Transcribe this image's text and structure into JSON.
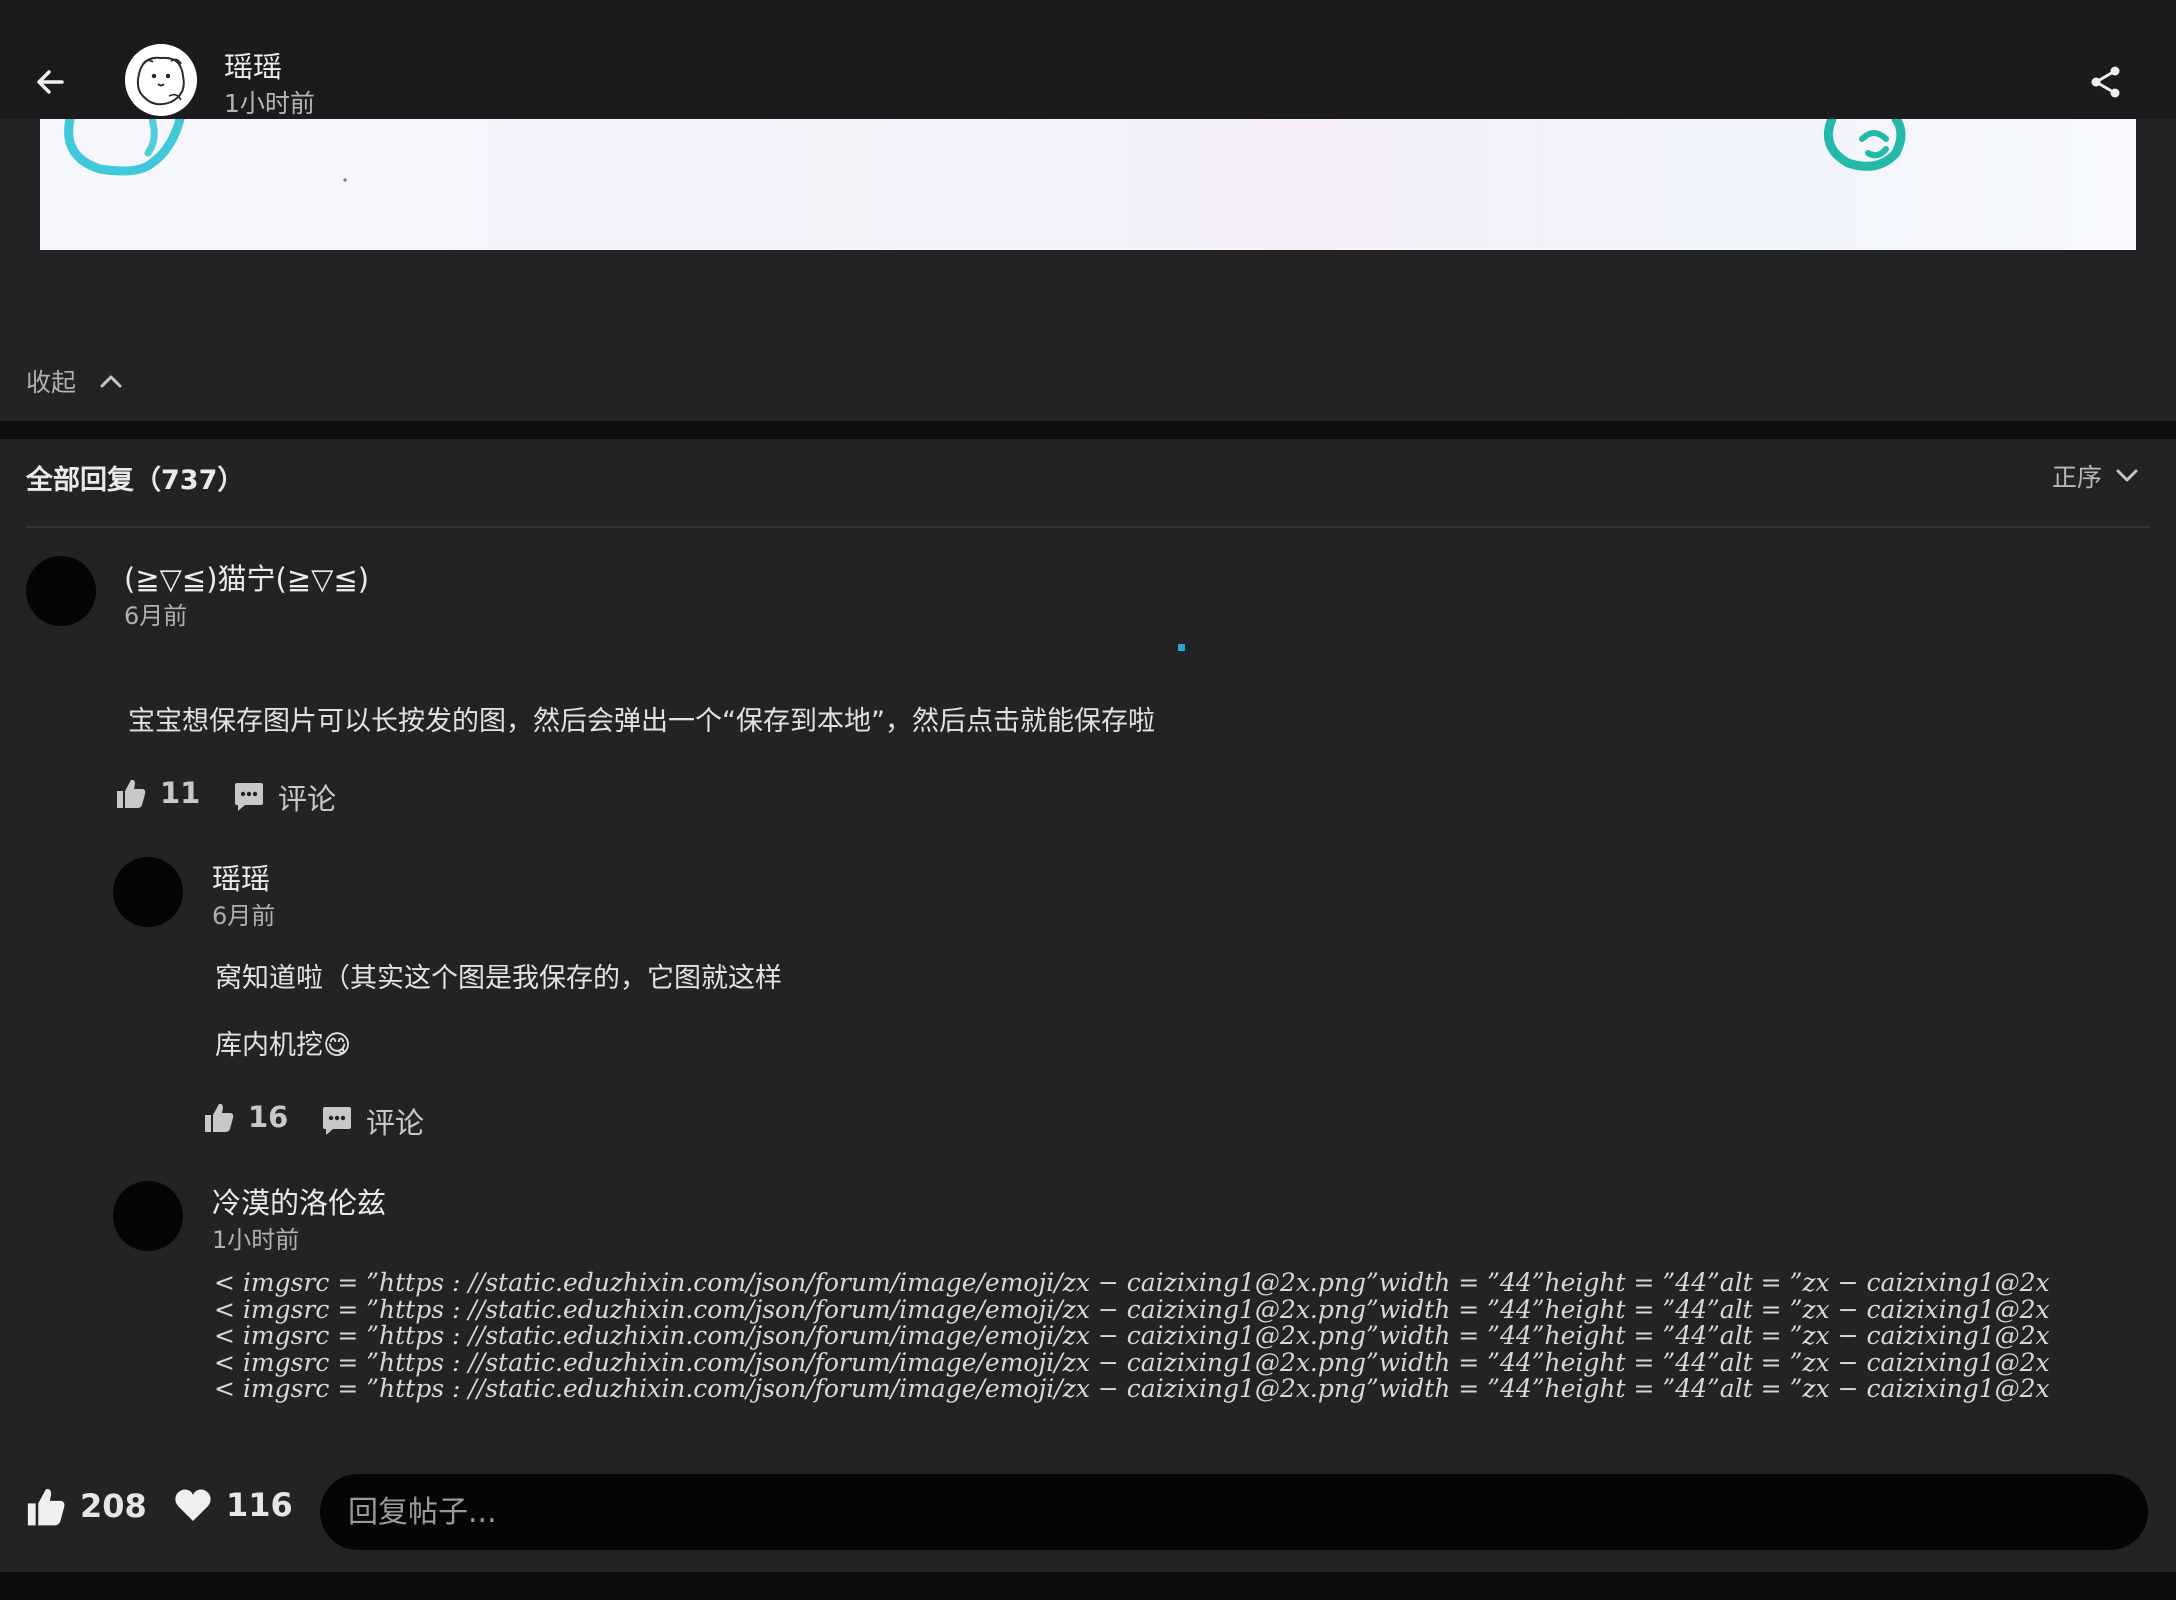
{
  "header": {
    "author_name": "瑶瑶",
    "post_time": "1小时前"
  },
  "collapse_label": "收起",
  "replies": {
    "title": "全部回复（737）",
    "sort_label": "正序"
  },
  "comments": [
    {
      "user": "(≧▽≦)猫宁(≧▽≦)",
      "time": "6月前",
      "text": "宝宝想保存图片可以长按发的图，然后会弹出一个“保存到本地”，然后点击就能保存啦",
      "likes": "11",
      "comment_label": "评论"
    },
    {
      "user": "瑶瑶",
      "time": "6月前",
      "text_line1": "窝知道啦（其实这个图是我保存的，它图就这样",
      "text_line2": "库内机挖",
      "text_line2_emoji": "😋",
      "likes": "16",
      "comment_label": "评论"
    },
    {
      "user": "冷漠的洛伦兹",
      "time": "1小时前",
      "lines": [
        "< imgsrc = ”https : //static.eduzhixin.com/json/forum/image/emoji/zx − caizixing1@2x.png”width = ”44”height = ”44”alt = ”zx − caizixing1@2x",
        "< imgsrc = ”https : //static.eduzhixin.com/json/forum/image/emoji/zx − caizixing1@2x.png”width = ”44”height = ”44”alt = ”zx − caizixing1@2x",
        "< imgsrc = ”https : //static.eduzhixin.com/json/forum/image/emoji/zx − caizixing1@2x.png”width = ”44”height = ”44”alt = ”zx − caizixing1@2x",
        "< imgsrc = ”https : //static.eduzhixin.com/json/forum/image/emoji/zx − caizixing1@2x.png”width = ”44”height = ”44”alt = ”zx − caizixing1@2x",
        "< imgsrc = ”https : //static.eduzhixin.com/json/forum/image/emoji/zx − caizixing1@2x.png”width = ”44”height = ”44”alt = ”zx − caizixing1@2x"
      ]
    }
  ],
  "bottom_bar": {
    "likes": "208",
    "favorites": "116",
    "reply_placeholder": "回复帖子..."
  },
  "colors": {
    "background": "#232325",
    "header": "#1b1b1d",
    "accent_mark": "#2aa7d8"
  },
  "icons": [
    "back-arrow-icon",
    "share-icon",
    "chevron-up-icon",
    "chevron-down-icon",
    "thumbs-up-icon",
    "comment-bubble-icon",
    "heart-icon"
  ]
}
